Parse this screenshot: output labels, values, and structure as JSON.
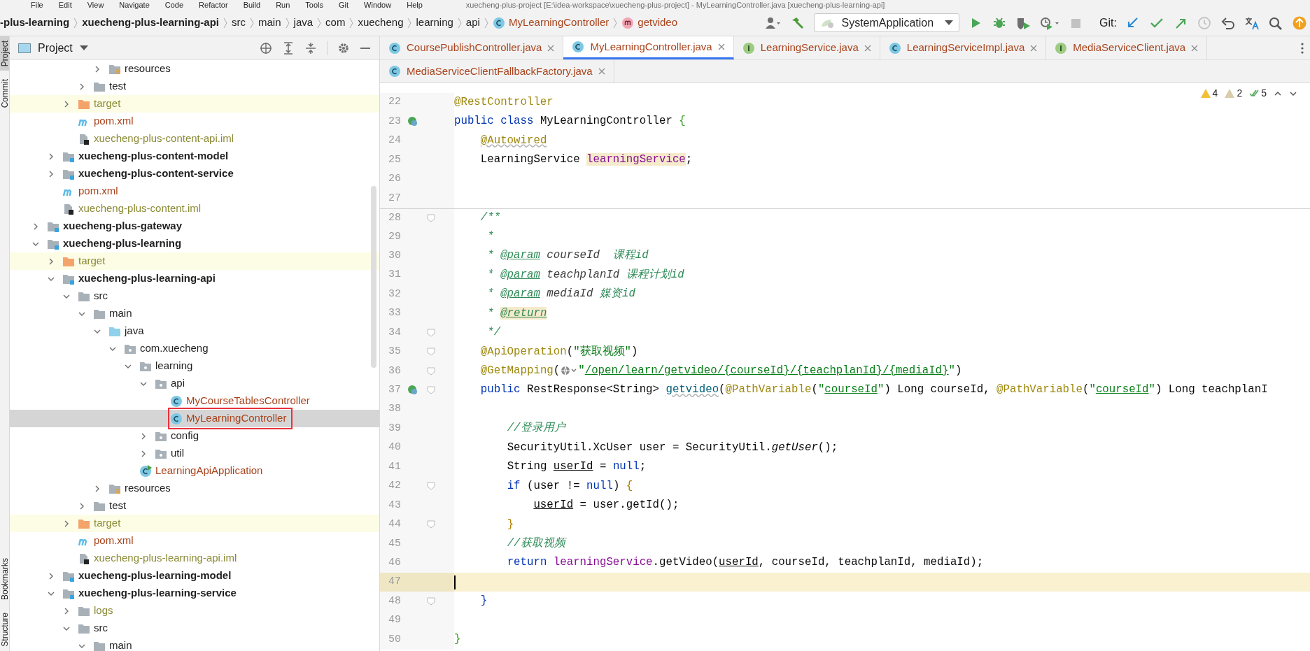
{
  "title_bar": {
    "menu": [
      "File",
      "Edit",
      "View",
      "Navigate",
      "Code",
      "Refactor",
      "Build",
      "Run",
      "Tools",
      "Git",
      "Window",
      "Help"
    ],
    "title": "xuecheng-plus-project [E:\\idea-workspace\\xuecheng-plus-project] - MyLearningController.java [xuecheng-plus-learning-api]"
  },
  "breadcrumbs": [
    {
      "label": "-plus-learning",
      "kind": "module"
    },
    {
      "label": "xuecheng-plus-learning-api",
      "kind": "module"
    },
    {
      "label": "src",
      "kind": "folder"
    },
    {
      "label": "main",
      "kind": "folder"
    },
    {
      "label": "java",
      "kind": "folder"
    },
    {
      "label": "com",
      "kind": "folder"
    },
    {
      "label": "xuecheng",
      "kind": "folder"
    },
    {
      "label": "learning",
      "kind": "folder"
    },
    {
      "label": "api",
      "kind": "folder"
    },
    {
      "label": "MyLearningController",
      "kind": "class"
    },
    {
      "label": "getvideo",
      "kind": "method"
    }
  ],
  "toolbar": [
    {
      "kind": "user-menu",
      "disabled": false
    },
    {
      "kind": "build",
      "disabled": false
    },
    {
      "kind": "run-config",
      "label": "SystemApplication",
      "disabled": false
    },
    {
      "kind": "run",
      "disabled": false
    },
    {
      "kind": "debug",
      "disabled": false
    },
    {
      "kind": "coverage",
      "disabled": false
    },
    {
      "kind": "profile",
      "disabled": false
    },
    {
      "kind": "stop",
      "disabled": true
    },
    {
      "kind": "label",
      "label": "Git:",
      "disabled": false
    },
    {
      "kind": "git-update",
      "disabled": false
    },
    {
      "kind": "git-commit",
      "disabled": false
    },
    {
      "kind": "git-push",
      "disabled": false
    },
    {
      "kind": "git-history",
      "disabled": true
    },
    {
      "kind": "rollback",
      "disabled": false
    },
    {
      "kind": "translate",
      "disabled": false
    },
    {
      "kind": "search",
      "disabled": false
    },
    {
      "kind": "updates",
      "disabled": false
    }
  ],
  "side_strip": {
    "top": [
      {
        "label": "Project",
        "selected": true
      },
      {
        "label": "Commit",
        "selected": false
      }
    ],
    "bottom": [
      {
        "label": "Bookmarks",
        "selected": false
      },
      {
        "label": "Structure",
        "selected": false
      }
    ]
  },
  "project_panel": {
    "title": "Project",
    "tree": [
      {
        "children": [
          {
            "children": [
              {
                "children": [
                  {
                    "children": [
                      {
                        "children": [
                          {
                            "label": "resources",
                            "kind": "resources",
                            "expanded": false,
                            "selected": false
                          }
                        ]
                      },
                      {
                        "label": "test",
                        "kind": "folder",
                        "expanded": false,
                        "selected": false
                      }
                    ]
                  },
                  {
                    "label": "target",
                    "kind": "excluded",
                    "color": "#8a8a36",
                    "expanded": false,
                    "selected": false
                  },
                  {
                    "label": "pom.xml",
                    "kind": "maven",
                    "color": "#a8431c",
                    "selected": false
                  },
                  {
                    "label": "xuecheng-plus-content-api.iml",
                    "kind": "iml",
                    "color": "#8a8a36",
                    "selected": false
                  }
                ]
              },
              {
                "label": "xuecheng-plus-content-model",
                "kind": "module",
                "expanded": false,
                "selected": false
              },
              {
                "label": "xuecheng-plus-content-service",
                "kind": "module",
                "expanded": false,
                "selected": false
              },
              {
                "label": "pom.xml",
                "kind": "maven",
                "color": "#a8431c",
                "selected": false
              },
              {
                "label": "xuecheng-plus-content.iml",
                "kind": "iml",
                "color": "#8a8a36",
                "selected": false
              }
            ]
          },
          {
            "label": "xuecheng-plus-gateway",
            "kind": "module",
            "expanded": false,
            "selected": false
          },
          {
            "label": "xuecheng-plus-learning",
            "kind": "module",
            "expanded": true,
            "selected": false,
            "children": [
              {
                "label": "target",
                "kind": "excluded",
                "color": "#8a8a36",
                "expanded": false,
                "selected": false
              },
              {
                "label": "xuecheng-plus-learning-api",
                "kind": "module",
                "expanded": true,
                "selected": false,
                "children": [
                  {
                    "label": "src",
                    "kind": "folder",
                    "expanded": true,
                    "selected": false,
                    "children": [
                      {
                        "label": "main",
                        "kind": "folder",
                        "expanded": true,
                        "selected": false,
                        "children": [
                          {
                            "label": "java",
                            "kind": "source",
                            "expanded": true,
                            "selected": false,
                            "children": [
                              {
                                "label": "com.xuecheng",
                                "kind": "package",
                                "expanded": true,
                                "selected": false,
                                "children": [
                                  {
                                    "label": "learning",
                                    "kind": "package",
                                    "expanded": true,
                                    "selected": false,
                                    "children": [
                                      {
                                        "label": "api",
                                        "kind": "package",
                                        "expanded": true,
                                        "selected": false,
                                        "children": [
                                          {
                                            "label": "MyCourseTablesController",
                                            "kind": "class",
                                            "color": "#a8431c",
                                            "selected": false,
                                            "marked": false
                                          },
                                          {
                                            "label": "MyLearningController",
                                            "kind": "class",
                                            "color": "#a8431c",
                                            "selected": true,
                                            "marked": true
                                          }
                                        ]
                                      },
                                      {
                                        "label": "config",
                                        "kind": "package",
                                        "expanded": false,
                                        "selected": false
                                      },
                                      {
                                        "label": "util",
                                        "kind": "package",
                                        "expanded": false,
                                        "selected": false
                                      }
                                    ]
                                  },
                                  {
                                    "label": "LearningApiApplication",
                                    "kind": "app-class",
                                    "color": "#a8431c",
                                    "selected": false
                                  }
                                ]
                              }
                            ]
                          },
                          {
                            "label": "resources",
                            "kind": "resources",
                            "expanded": false,
                            "selected": false
                          }
                        ]
                      },
                      {
                        "label": "test",
                        "kind": "folder",
                        "expanded": false,
                        "selected": false
                      }
                    ]
                  },
                  {
                    "label": "target",
                    "kind": "excluded",
                    "color": "#8a8a36",
                    "expanded": false,
                    "selected": false
                  },
                  {
                    "label": "pom.xml",
                    "kind": "maven",
                    "color": "#a8431c",
                    "selected": false
                  },
                  {
                    "label": "xuecheng-plus-learning-api.iml",
                    "kind": "iml",
                    "color": "#8a8a36",
                    "selected": false
                  }
                ]
              },
              {
                "label": "xuecheng-plus-learning-model",
                "kind": "module",
                "expanded": false,
                "selected": false
              },
              {
                "label": "xuecheng-plus-learning-service",
                "kind": "module",
                "expanded": true,
                "selected": false,
                "children": [
                  {
                    "label": "logs",
                    "kind": "folder",
                    "color": "#8a8a36",
                    "expanded": false,
                    "selected": false
                  },
                  {
                    "label": "src",
                    "kind": "folder",
                    "expanded": true,
                    "selected": false,
                    "children": [
                      {
                        "label": "main",
                        "kind": "folder",
                        "expanded": true,
                        "selected": false
                      }
                    ]
                  }
                ]
              }
            ]
          }
        ]
      }
    ]
  },
  "editor_tabs": [
    [
      {
        "label": "CoursePublishController.java",
        "kind": "class",
        "color": "#a8431c",
        "selected": false
      },
      {
        "label": "MyLearningController.java",
        "kind": "class",
        "color": "#a8431c",
        "selected": true
      },
      {
        "label": "LearningService.java",
        "kind": "interface",
        "color": "#a8431c",
        "selected": false
      },
      {
        "label": "LearningServiceImpl.java",
        "kind": "class",
        "color": "#a8431c",
        "selected": false
      },
      {
        "label": "MediaServiceClient.java",
        "kind": "interface",
        "color": "#a8431c",
        "selected": false
      }
    ],
    [
      {
        "label": "MediaServiceClientFallbackFactory.java",
        "kind": "class",
        "color": "#a8431c",
        "selected": false
      }
    ]
  ],
  "inspections": [
    {
      "kind": "warning",
      "count": "4"
    },
    {
      "kind": "weak-warning",
      "count": "2"
    },
    {
      "kind": "typo",
      "count": "5"
    }
  ],
  "code": [
    {
      "number": "22",
      "bean": false,
      "fold": false,
      "current": false,
      "separator": false,
      "segments": [
        {
          "kind": "ann",
          "text": "@RestController"
        }
      ]
    },
    {
      "number": "23",
      "bean": true,
      "fold": false,
      "current": false,
      "separator": false,
      "segments": [
        {
          "kind": "kw",
          "text": "public class "
        },
        {
          "kind": "plain",
          "text": "MyLearningController "
        },
        {
          "kind": "brace-a",
          "text": "{"
        }
      ]
    },
    {
      "number": "24",
      "bean": false,
      "fold": false,
      "current": false,
      "separator": false,
      "segments": [
        {
          "kind": "ann-wavy",
          "text": "    @Autowired"
        }
      ]
    },
    {
      "number": "25",
      "bean": false,
      "fold": false,
      "current": false,
      "separator": false,
      "segments": [
        {
          "kind": "plain",
          "text": "    LearningService "
        },
        {
          "kind": "field-hl",
          "text": "learningService"
        },
        {
          "kind": "plain",
          "text": ";"
        }
      ]
    },
    {
      "number": "26",
      "bean": false,
      "fold": false,
      "current": false,
      "separator": false
    },
    {
      "number": "27",
      "bean": false,
      "fold": false,
      "current": false,
      "separator": false
    },
    {
      "number": "28",
      "bean": false,
      "fold": true,
      "current": false,
      "separator": true,
      "segments": [
        {
          "kind": "jdoc",
          "text": "    /**"
        }
      ]
    },
    {
      "number": "29",
      "bean": false,
      "fold": false,
      "current": false,
      "separator": false,
      "segments": [
        {
          "kind": "jdoc",
          "text": "     *"
        }
      ]
    },
    {
      "number": "30",
      "bean": false,
      "fold": false,
      "current": false,
      "separator": false,
      "segments": [
        {
          "kind": "jdoc",
          "text": "     * "
        },
        {
          "kind": "jdoc-tag",
          "text": "@param"
        },
        {
          "kind": "jdoc-param",
          "text": " courseId  "
        },
        {
          "kind": "jdoc",
          "text": "课程id"
        }
      ]
    },
    {
      "number": "31",
      "bean": false,
      "fold": false,
      "current": false,
      "separator": false,
      "segments": [
        {
          "kind": "jdoc",
          "text": "     * "
        },
        {
          "kind": "jdoc-tag",
          "text": "@param"
        },
        {
          "kind": "jdoc-param",
          "text": " teachplanId "
        },
        {
          "kind": "jdoc",
          "text": "课程计划id"
        }
      ]
    },
    {
      "number": "32",
      "bean": false,
      "fold": false,
      "current": false,
      "separator": false,
      "segments": [
        {
          "kind": "jdoc",
          "text": "     * "
        },
        {
          "kind": "jdoc-tag",
          "text": "@param"
        },
        {
          "kind": "jdoc-param",
          "text": " mediaId "
        },
        {
          "kind": "jdoc",
          "text": "媒资id"
        }
      ]
    },
    {
      "number": "33",
      "bean": false,
      "fold": false,
      "current": false,
      "separator": false,
      "segments": [
        {
          "kind": "jdoc",
          "text": "     * "
        },
        {
          "kind": "jdoc-tag-hl",
          "text": "@return"
        }
      ]
    },
    {
      "number": "34",
      "bean": false,
      "fold": true,
      "current": false,
      "separator": false,
      "segments": [
        {
          "kind": "jdoc",
          "text": "     */"
        }
      ]
    },
    {
      "number": "35",
      "bean": false,
      "fold": true,
      "current": false,
      "separator": false,
      "segments": [
        {
          "kind": "ann",
          "text": "    @ApiOperation"
        },
        {
          "kind": "plain",
          "text": "("
        },
        {
          "kind": "str",
          "text": "\"获取视频\""
        },
        {
          "kind": "plain",
          "text": ")"
        }
      ]
    },
    {
      "number": "36",
      "bean": false,
      "fold": true,
      "current": false,
      "separator": false,
      "segments": [
        {
          "kind": "ann",
          "text": "    @GetMapping"
        },
        {
          "kind": "plain",
          "text": "("
        },
        {
          "kind": "inlay"
        },
        {
          "kind": "str",
          "text": "\""
        },
        {
          "kind": "str-ul",
          "text": "/open/learn/getvideo/{courseId}/{teachplanId}/{mediaId}"
        },
        {
          "kind": "str",
          "text": "\""
        },
        {
          "kind": "plain",
          "text": ")"
        }
      ]
    },
    {
      "number": "37",
      "bean": true,
      "fold": true,
      "current": false,
      "separator": false,
      "segments": [
        {
          "kind": "kw",
          "text": "    public "
        },
        {
          "kind": "plain",
          "text": "RestResponse<String> "
        },
        {
          "kind": "method-decl",
          "text": "getvideo"
        },
        {
          "kind": "plain",
          "text": "("
        },
        {
          "kind": "ann",
          "text": "@PathVariable"
        },
        {
          "kind": "plain",
          "text": "("
        },
        {
          "kind": "str",
          "text": "\""
        },
        {
          "kind": "str-ul",
          "text": "courseId"
        },
        {
          "kind": "str",
          "text": "\""
        },
        {
          "kind": "plain",
          "text": ") Long courseId, "
        },
        {
          "kind": "ann",
          "text": "@PathVariable"
        },
        {
          "kind": "plain",
          "text": "("
        },
        {
          "kind": "str",
          "text": "\""
        },
        {
          "kind": "str-ul",
          "text": "courseId"
        },
        {
          "kind": "str",
          "text": "\""
        },
        {
          "kind": "plain",
          "text": ") Long teachplanI"
        }
      ]
    },
    {
      "number": "38",
      "bean": false,
      "fold": false,
      "current": false,
      "separator": false
    },
    {
      "number": "39",
      "bean": false,
      "fold": false,
      "current": false,
      "separator": false,
      "segments": [
        {
          "kind": "cmt",
          "text": "        //登录用户"
        }
      ]
    },
    {
      "number": "40",
      "bean": false,
      "fold": false,
      "current": false,
      "separator": false,
      "segments": [
        {
          "kind": "plain",
          "text": "        SecurityUtil.XcUser user = SecurityUtil."
        },
        {
          "kind": "static-call",
          "text": "getUser"
        },
        {
          "kind": "plain",
          "text": "();"
        }
      ]
    },
    {
      "number": "41",
      "bean": false,
      "fold": false,
      "current": false,
      "separator": false,
      "segments": [
        {
          "kind": "plain",
          "text": "        String "
        },
        {
          "kind": "var-ul",
          "text": "userId"
        },
        {
          "kind": "plain",
          "text": " = "
        },
        {
          "kind": "kw",
          "text": "null"
        },
        {
          "kind": "plain",
          "text": ";"
        }
      ]
    },
    {
      "number": "42",
      "bean": false,
      "fold": true,
      "current": false,
      "separator": false,
      "segments": [
        {
          "kind": "kw",
          "text": "        if "
        },
        {
          "kind": "plain",
          "text": "(user != "
        },
        {
          "kind": "kw",
          "text": "null"
        },
        {
          "kind": "plain",
          "text": ") "
        },
        {
          "kind": "brace-b",
          "text": "{"
        }
      ]
    },
    {
      "number": "43",
      "bean": false,
      "fold": false,
      "current": false,
      "separator": false,
      "segments": [
        {
          "kind": "var-ul",
          "text": "            userId"
        },
        {
          "kind": "plain",
          "text": " = user.getId();"
        }
      ]
    },
    {
      "number": "44",
      "bean": false,
      "fold": true,
      "current": false,
      "separator": false,
      "segments": [
        {
          "kind": "brace-b",
          "text": "        }"
        }
      ]
    },
    {
      "number": "45",
      "bean": false,
      "fold": false,
      "current": false,
      "separator": false,
      "segments": [
        {
          "kind": "cmt",
          "text": "        //获取视频"
        }
      ]
    },
    {
      "number": "46",
      "bean": false,
      "fold": false,
      "current": false,
      "separator": false,
      "segments": [
        {
          "kind": "kw",
          "text": "        return "
        },
        {
          "kind": "field",
          "text": "learningService"
        },
        {
          "kind": "plain",
          "text": ".getVideo("
        },
        {
          "kind": "var-ul",
          "text": "userId"
        },
        {
          "kind": "plain",
          "text": ", courseId, teachplanId, mediaId);"
        }
      ]
    },
    {
      "number": "47",
      "bean": false,
      "fold": false,
      "current": true,
      "separator": false
    },
    {
      "number": "48",
      "bean": false,
      "fold": true,
      "current": false,
      "separator": false,
      "segments": [
        {
          "kind": "brace-c",
          "text": "    }"
        }
      ]
    },
    {
      "number": "49",
      "bean": false,
      "fold": false,
      "current": false,
      "separator": false
    },
    {
      "number": "50",
      "bean": false,
      "fold": false,
      "current": false,
      "separator": false,
      "segments": [
        {
          "kind": "brace-a",
          "text": "}"
        }
      ]
    }
  ]
}
